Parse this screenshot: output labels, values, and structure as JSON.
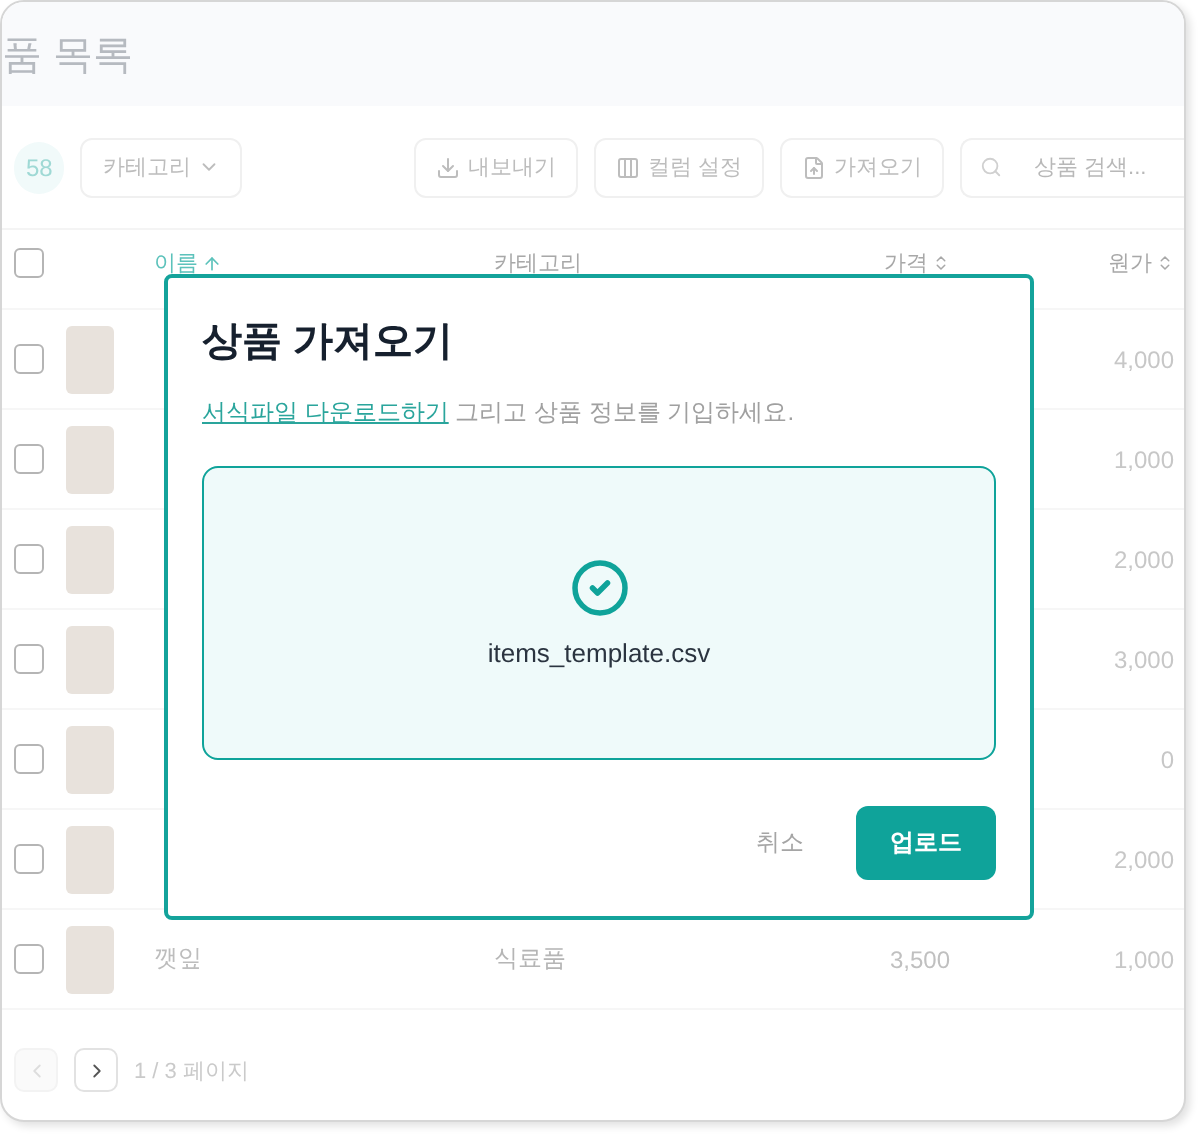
{
  "header": {
    "title": "품 목록"
  },
  "toolbar": {
    "count": "58",
    "category_filter": "카테고리",
    "buttons": [
      {
        "label": "내보내기",
        "kind": "export"
      },
      {
        "label": "컬럼 설정",
        "kind": "columns"
      },
      {
        "label": "가져오기",
        "kind": "import"
      }
    ],
    "search": {
      "placeholder": "상품 검색..."
    }
  },
  "table": {
    "select_all_checked": false,
    "columns": [
      {
        "label": "이름",
        "sortable": true,
        "sorted": true
      },
      {
        "label": "카테고리",
        "sortable": false,
        "sorted": false
      },
      {
        "label": "가격",
        "sortable": true,
        "sorted": false
      },
      {
        "label": "원가",
        "sortable": true,
        "sorted": false
      }
    ],
    "rows": [
      {
        "checked": false,
        "cost": "4,000"
      },
      {
        "checked": false,
        "cost": "1,000"
      },
      {
        "checked": false,
        "cost": "2,000"
      },
      {
        "checked": false,
        "cost": "3,000"
      },
      {
        "checked": false,
        "cost": "0"
      },
      {
        "checked": false,
        "cost": "2,000"
      },
      {
        "checked": false,
        "name": "깻잎",
        "category": "식료품",
        "price": "3,500",
        "cost": "1,000"
      }
    ]
  },
  "pagination": {
    "buttons": [
      {
        "kind": "prev",
        "disabled": true
      },
      {
        "kind": "next",
        "disabled": false
      }
    ],
    "label": "1 / 3 페이지"
  },
  "modal": {
    "title": "상품 가져오기",
    "link": "서식파일 다운로드하기",
    "instruction": "그리고 상품 정보를 기입하세요.",
    "file": {
      "name": "items_template.csv",
      "uploaded": true
    },
    "cancel": "취소",
    "submit": "업로드"
  }
}
